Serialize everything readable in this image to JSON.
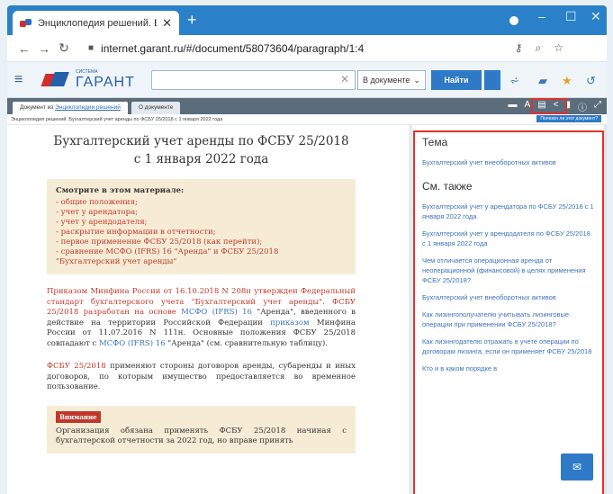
{
  "browser": {
    "tab_title": "Энциклопедия решений. Бухгал",
    "tab_close": "✕",
    "new_tab": "+",
    "url": "internet.garant.ru/#/document/58073604/paragraph/1:4",
    "minimize": "–",
    "maximize": "☐",
    "close": "✕"
  },
  "garant": {
    "logo_small": "СИСТЕМА",
    "logo": "ГАРАНТ",
    "search_clear": "✕",
    "scope": "В документе",
    "find": "Найти"
  },
  "doc_tabs": [
    {
      "prefix": "Документ из ",
      "link": "Энциклопедии решений"
    },
    {
      "prefix": "О документе",
      "link": ""
    }
  ],
  "breadcrumb": "Энциклопедия решений. Бухгалтерский учет аренды по ФСБУ 25/2018 с 1 января 2022 года",
  "breadcrumb_right": "Полезен ли этот документ?",
  "document": {
    "title_line1": "Бухгалтерский учет аренды по ФСБУ 25/2018",
    "title_line2": "с 1 января 2022 года",
    "seealso_head": "Смотрите в этом материале:",
    "seealso_items": [
      "- общие положения;",
      "- учет у арендатора;",
      "- учет у арендодателя;",
      "- раскрытие информации в отчетности;",
      "- первое применение ФСБУ 25/2018 (как перейти);",
      "- сравнение МСФО (IFRS) 16 \"Аренда\" и ФСБУ 25/2018",
      "\"Бухгалтерский учет аренды\""
    ],
    "para1_a": "Приказом Минфина России от 16.10.2018 N 208н утвержден Федеральный стандарт бухгалтерского учета \"Бухгалтерский учет аренды\". ФСБУ 25/2018 разработан на основе ",
    "para1_link1": "МСФО (IFRS) 16",
    "para1_b": " \"Аренда\", введенного в действие на территории Российской Федерации ",
    "para1_link2": "приказом",
    "para1_c": " Минфина России от 11.07.2016 N 111н. Основные положения ФСБУ 25/2018 совпадают с ",
    "para1_link3": "МСФО (IFRS) 16",
    "para1_d": " \"Аренда\" (см. сравнительную таблицу).",
    "para2_ref": "ФСБУ 25/2018",
    "para2_rest": " применяют стороны договоров аренды, субаренды и иных договоров, по которым имущество предоставляется во временное пользование.",
    "attention_badge": "Внимание",
    "attention_text": "Организация обязана применять ФСБУ 25/2018 начиная с бухгалтерской отчетности за 2022 год, но вправе принять"
  },
  "panel": {
    "topic_head": "Тема",
    "topic_link": "Бухгалтерский учет внеоборотных активов",
    "seealso_head": "См. также",
    "links": [
      "Бухгалтерский учет у арендатора по ФСБУ 25/2018 с 1 января 2022 года",
      "Бухгалтерский учет у арендодателя по ФСБУ 25/2018 с 1 января 2022 года",
      "Чем отличается операционная аренда от неоперационной (финансовой) в целях применения ФСБУ 25/2018?",
      "Бухгалтерский учет внеоборотных активов",
      "Как лизингополучателю учитывать лизинговые операции при применении ФСБУ 25/2018?",
      "Как лизингодателю отражать в учете операции по договорам лизинга, если он применяет ФСБУ 25/2018",
      "Кто и в каком порядке в"
    ]
  }
}
